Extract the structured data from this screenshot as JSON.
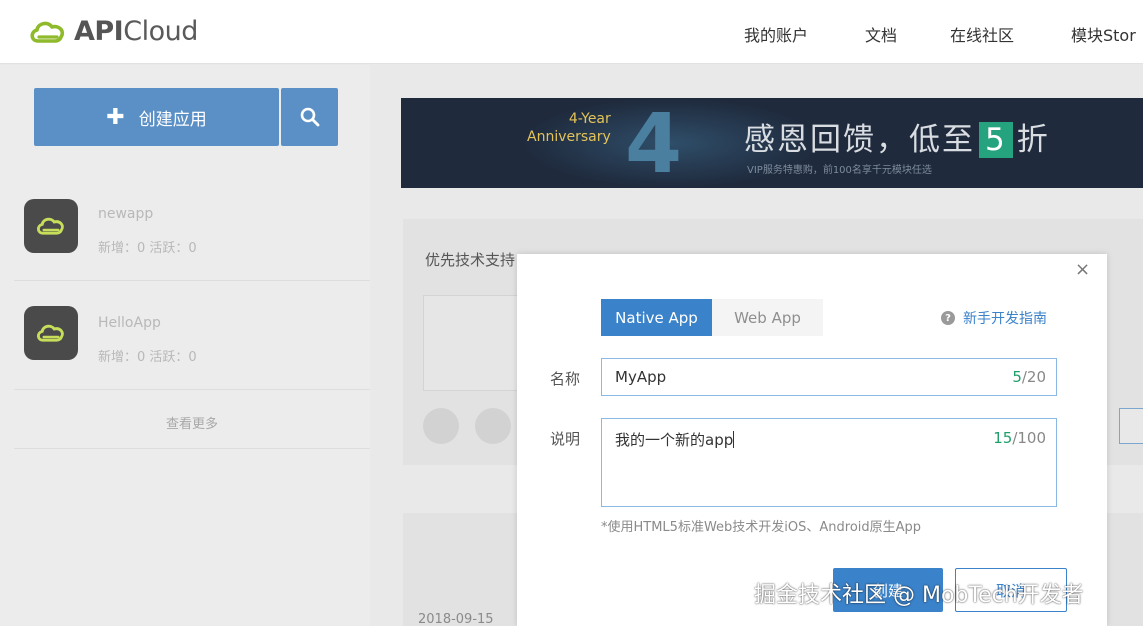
{
  "header": {
    "logo_text": "APICloud",
    "logo_bold": "API",
    "logo_rest": "Cloud",
    "nav": [
      "我的账户",
      "文档",
      "在线社区",
      "模块Stor"
    ]
  },
  "sidebar": {
    "create_label": "创建应用",
    "search_icon": "search-icon",
    "apps": [
      {
        "name": "newapp",
        "stats": "新增：0  活跃：0"
      },
      {
        "name": "HelloApp",
        "stats": "新增：0  活跃：0"
      }
    ],
    "more_label": "查看更多"
  },
  "banner": {
    "anniversary_line1": "4-Year",
    "anniversary_line2": "Anniversary",
    "big_number": "4",
    "title_pre": "感恩回馈，低至",
    "title_num": "5",
    "title_post": "折",
    "subtitle": "VIP服务特惠购，前100名享千元模块任选"
  },
  "panel": {
    "title": "优先技术支持",
    "date": "2018-09-15"
  },
  "modal": {
    "close": "×",
    "tabs": [
      {
        "label": "Native App",
        "active": true
      },
      {
        "label": "Web App",
        "active": false
      }
    ],
    "guide_label": "新手开发指南",
    "name_label": "名称",
    "name_value": "MyApp",
    "name_count": "5",
    "name_max": "/20",
    "desc_label": "说明",
    "desc_value": "我的一个新的app",
    "desc_count": "15",
    "desc_max": "/100",
    "hint": "*使用HTML5标准Web技术开发iOS、Android原生App",
    "ok_label": "创建",
    "cancel_label": "取消"
  },
  "watermark": "掘金技术社区 @ MobTech开发者",
  "colors": {
    "primary": "#3a82c9",
    "sidebar_button": "#5b90c6",
    "count_green": "#1f9f6a",
    "logo_green": "#8fba2b"
  }
}
